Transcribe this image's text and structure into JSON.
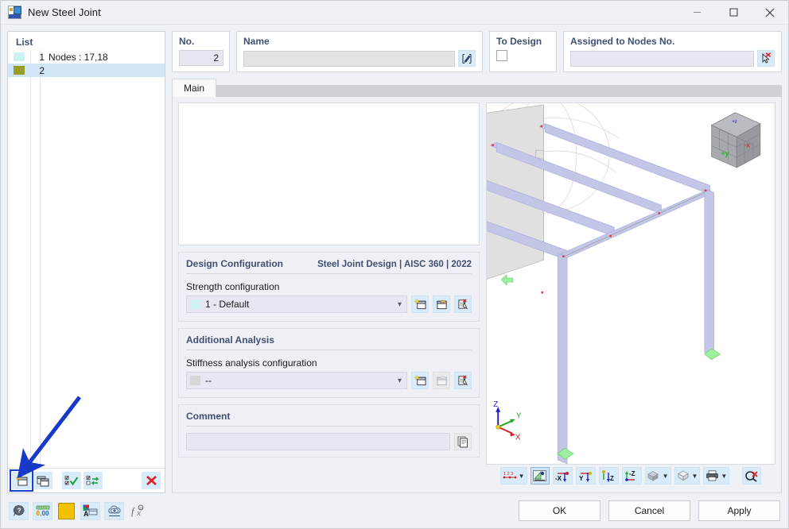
{
  "window": {
    "title": "New Steel Joint",
    "icon": "steel-joint-app-icon",
    "controls": {
      "minimize": "─",
      "maximize": "□",
      "close": "✕"
    }
  },
  "list_panel": {
    "header": "List",
    "rows": [
      {
        "number": "1",
        "text": "Nodes : 17,18",
        "color": "#cdf2f2",
        "selected": false
      },
      {
        "number": "2",
        "text": "",
        "color": "#9a9b28",
        "selected": true
      }
    ],
    "toolbar": [
      {
        "name": "new-item-button",
        "icon": "new-window-star-icon",
        "highlighted": true
      },
      {
        "name": "copy-item-button",
        "icon": "copy-window-icon",
        "highlighted": false
      },
      {
        "name": "select-all-button",
        "icon": "checklist-check-icon",
        "highlighted": false
      },
      {
        "name": "invert-selection-button",
        "icon": "checklist-swap-icon",
        "highlighted": false
      },
      {
        "name": "delete-item-button",
        "icon": "red-x-icon",
        "label": "✕"
      }
    ]
  },
  "fields": {
    "no": {
      "label": "No.",
      "value": "2"
    },
    "name": {
      "label": "Name",
      "value": "",
      "placeholder": "",
      "edit_icon": "pencil-edit-icon"
    },
    "to_design": {
      "label": "To Design",
      "checked": false
    },
    "assigned_nodes": {
      "label": "Assigned to Nodes No.",
      "value": "",
      "pick_icon": "pick-nodes-cursor-icon"
    }
  },
  "tabs": [
    {
      "label": "Main",
      "active": true
    }
  ],
  "design_configuration": {
    "title": "Design Configuration",
    "standard": "Steel Joint Design | AISC 360 | 2022",
    "field_label": "Strength configuration",
    "value": "1 - Default",
    "swatch": "#cdf2f2",
    "buttons": [
      {
        "name": "new-configuration-button",
        "icon": "new-config-star-icon",
        "enabled": true
      },
      {
        "name": "edit-configuration-button",
        "icon": "edit-config-hand-icon",
        "enabled": true
      },
      {
        "name": "delete-configuration-button",
        "icon": "delete-config-red-x-icon",
        "enabled": true
      }
    ]
  },
  "additional_analysis": {
    "title": "Additional Analysis",
    "field_label": "Stiffness analysis configuration",
    "value": "--",
    "swatch": "#d6d6d6",
    "buttons": [
      {
        "name": "new-stiffness-config-button",
        "icon": "new-config-star-icon",
        "enabled": true
      },
      {
        "name": "edit-stiffness-config-button",
        "icon": "edit-config-hand-icon",
        "enabled": false
      },
      {
        "name": "delete-stiffness-config-button",
        "icon": "delete-config-red-x-icon",
        "enabled": true
      }
    ]
  },
  "comment": {
    "title": "Comment",
    "value": "",
    "copy_icon": "copy-pages-icon"
  },
  "viewport": {
    "axis_triad": {
      "z": "Z",
      "y": "Y",
      "x": "X"
    },
    "view_cube": {
      "front": "+y",
      "right": "-x"
    },
    "toolbar": [
      {
        "name": "numbering-dropdown-button",
        "icon": "numbering-123-icon",
        "dropdown": true
      },
      {
        "name": "render-mode-button",
        "icon": "render-triangle-icon",
        "selected": true
      },
      {
        "name": "view-minus-x-button",
        "icon": "axis-x-negative-icon",
        "label": "-X"
      },
      {
        "name": "view-y-button",
        "icon": "axis-y-icon",
        "label": "Y"
      },
      {
        "name": "view-z-button",
        "icon": "axis-z-icon",
        "label": "Z"
      },
      {
        "name": "view-minus-z-button",
        "icon": "axis-z-negative-icon",
        "label": "-Z"
      },
      {
        "name": "shading-dropdown-button",
        "icon": "solid-shading-icon",
        "dropdown": true
      },
      {
        "name": "wireframe-dropdown-button",
        "icon": "wireframe-cube-icon",
        "dropdown": true
      },
      {
        "name": "print-dropdown-button",
        "icon": "printer-icon",
        "dropdown": true
      },
      {
        "name": "clear-selection-button",
        "icon": "magnifier-red-x-icon"
      }
    ]
  },
  "footer": {
    "icons": [
      {
        "name": "help-button",
        "icon": "question-speech-icon"
      },
      {
        "name": "number-format-button",
        "icon": "decimal-places-icon"
      },
      {
        "name": "color-swatch-button",
        "icon": "yellow-color-square-icon"
      },
      {
        "name": "display-properties-button",
        "icon": "font-color-window-icon"
      },
      {
        "name": "view-settings-button",
        "icon": "cloud-view-icon"
      },
      {
        "name": "function-button",
        "icon": "fx-function-icon"
      }
    ],
    "buttons": [
      {
        "name": "ok-button",
        "label": "OK"
      },
      {
        "name": "cancel-button",
        "label": "Cancel"
      },
      {
        "name": "apply-button",
        "label": "Apply"
      }
    ]
  },
  "annotation": {
    "arrow_color": "#1838c8",
    "points_to": "new-item-button"
  }
}
